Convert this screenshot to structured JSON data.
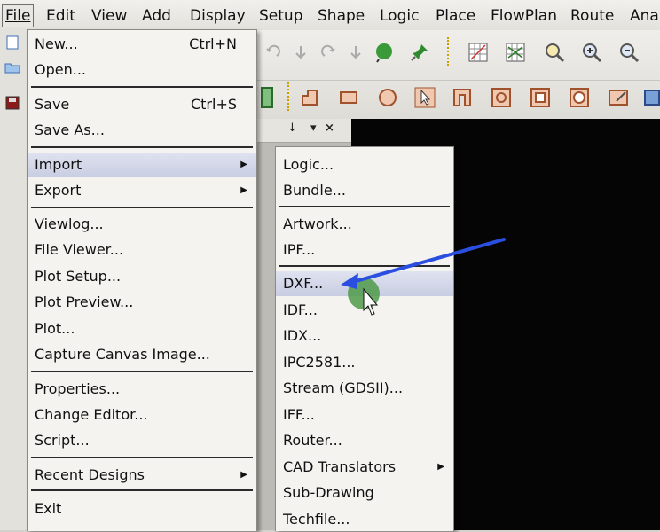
{
  "menubar": {
    "items": [
      "File",
      "Edit",
      "View",
      "Add",
      "Display",
      "Setup",
      "Shape",
      "Logic",
      "Place",
      "FlowPlan",
      "Route",
      "Anal"
    ]
  },
  "dock": {
    "pin": "↓",
    "chev": "▾",
    "close": "×"
  },
  "file_menu": {
    "new": "New...",
    "new_sc": "Ctrl+N",
    "open": "Open...",
    "save": "Save",
    "save_sc": "Ctrl+S",
    "save_as": "Save As...",
    "import": "Import",
    "export": "Export",
    "viewlog": "Viewlog...",
    "file_viewer": "File Viewer...",
    "plot_setup": "Plot Setup...",
    "plot_preview": "Plot Preview...",
    "plot": "Plot...",
    "capture": "Capture Canvas Image...",
    "properties": "Properties...",
    "change_editor": "Change Editor...",
    "script": "Script...",
    "recent": "Recent Designs",
    "exit": "Exit"
  },
  "import_menu": {
    "logic": "Logic...",
    "bundle": "Bundle...",
    "artwork": "Artwork...",
    "ipf": "IPF...",
    "dxf": "DXF...",
    "idf": "IDF...",
    "idx": "IDX...",
    "ipc": "IPC2581...",
    "stream": "Stream (GDSII)...",
    "iff": "IFF...",
    "router": "Router...",
    "cad": "CAD Translators",
    "subdrawing": "Sub-Drawing",
    "techfile": "Techfile..."
  },
  "colors": {
    "highlight": "#cdd1e6",
    "arrow": "#2a4fe0",
    "cursor_dot": "#4f9a4a",
    "canvas": "#050505"
  }
}
